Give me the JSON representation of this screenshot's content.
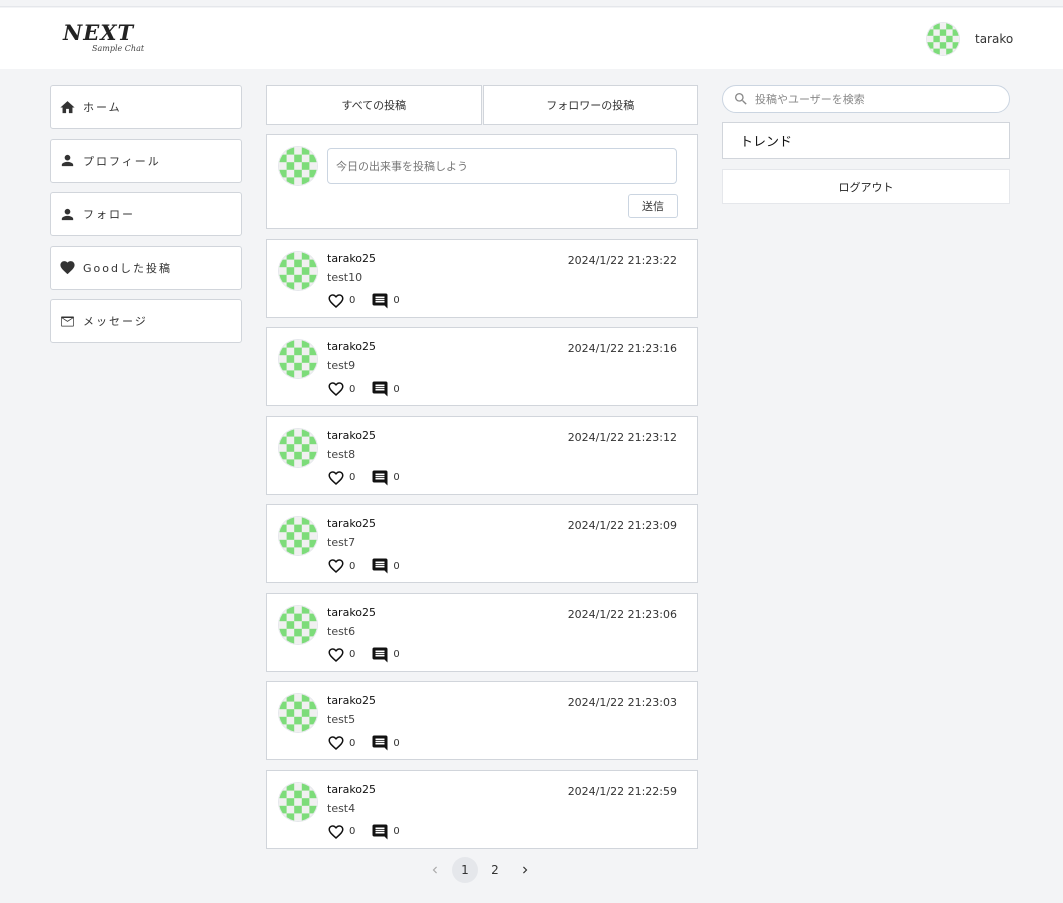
{
  "header": {
    "logo_main": "NEXT",
    "logo_sub": "Sample Chat",
    "username": "tarako"
  },
  "sidebar": {
    "items": [
      {
        "label": "ホーム",
        "icon": "home-icon"
      },
      {
        "label": "プロフィール",
        "icon": "person-icon"
      },
      {
        "label": "フォロー",
        "icon": "person-icon"
      },
      {
        "label": "Goodした投稿",
        "icon": "heart-icon"
      },
      {
        "label": "メッセージ",
        "icon": "mail-icon"
      }
    ]
  },
  "tabs": [
    {
      "label": "すべての投稿"
    },
    {
      "label": "フォロワーの投稿"
    }
  ],
  "composer": {
    "placeholder": "今日の出来事を投稿しよう",
    "send_label": "送信"
  },
  "posts": [
    {
      "user": "tarako25",
      "time": "2024/1/22 21:23:22",
      "text": "test10",
      "likes": "0",
      "comments": "0"
    },
    {
      "user": "tarako25",
      "time": "2024/1/22 21:23:16",
      "text": "test9",
      "likes": "0",
      "comments": "0"
    },
    {
      "user": "tarako25",
      "time": "2024/1/22 21:23:12",
      "text": "test8",
      "likes": "0",
      "comments": "0"
    },
    {
      "user": "tarako25",
      "time": "2024/1/22 21:23:09",
      "text": "test7",
      "likes": "0",
      "comments": "0"
    },
    {
      "user": "tarako25",
      "time": "2024/1/22 21:23:06",
      "text": "test6",
      "likes": "0",
      "comments": "0"
    },
    {
      "user": "tarako25",
      "time": "2024/1/22 21:23:03",
      "text": "test5",
      "likes": "0",
      "comments": "0"
    },
    {
      "user": "tarako25",
      "time": "2024/1/22 21:22:59",
      "text": "test4",
      "likes": "0",
      "comments": "0"
    }
  ],
  "pagination": {
    "pages": [
      "1",
      "2"
    ],
    "current": "1"
  },
  "right": {
    "search_placeholder": "投稿やユーザーを検索",
    "trend_label": "トレンド",
    "logout_label": "ログアウト"
  },
  "colors": {
    "avatar_pattern": "#7ddc7a",
    "background": "#f3f4f6"
  }
}
